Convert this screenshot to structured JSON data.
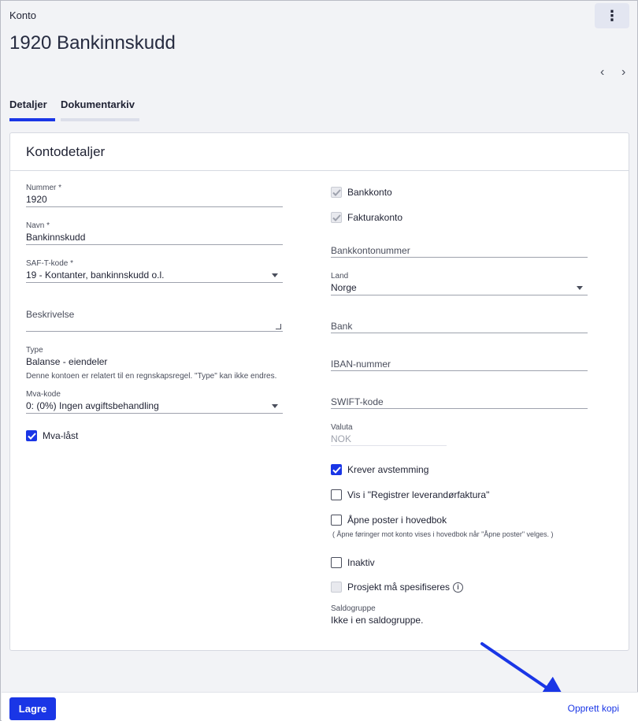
{
  "header": {
    "eyebrow": "Konto",
    "title": "1920 Bankinnskudd",
    "menu_icon": "⋮",
    "prev_icon": "‹",
    "next_icon": "›"
  },
  "tabs": [
    {
      "label": "Detaljer",
      "active": true
    },
    {
      "label": "Dokumentarkiv",
      "active": false
    }
  ],
  "card": {
    "title": "Kontodetaljer",
    "left": {
      "nummer": {
        "label": "Nummer *",
        "value": "1920"
      },
      "navn": {
        "label": "Navn *",
        "value": "Bankinnskudd"
      },
      "saft": {
        "label": "SAF-T-kode *",
        "value": "19 - Kontanter, bankinnskudd o.l."
      },
      "beskrivelse": {
        "placeholder": "Beskrivelse"
      },
      "type": {
        "label": "Type",
        "value": "Balanse - eiendeler",
        "hint": "Denne kontoen er relatert til en regnskapsregel. \"Type\" kan ikke endres."
      },
      "mva": {
        "label": "Mva-kode",
        "value": "0: (0%) Ingen avgiftsbehandling"
      },
      "mva_laast": {
        "label": "Mva-låst",
        "checked": true
      }
    },
    "right": {
      "bankkonto": {
        "label": "Bankkonto",
        "checked": true,
        "disabled": true
      },
      "fakturakonto": {
        "label": "Fakturakonto",
        "checked": true,
        "disabled": true
      },
      "bankkontonummer": {
        "placeholder": "Bankkontonummer"
      },
      "land": {
        "label": "Land",
        "value": "Norge"
      },
      "bank": {
        "placeholder": "Bank"
      },
      "iban": {
        "placeholder": "IBAN-nummer"
      },
      "swift": {
        "placeholder": "SWIFT-kode"
      },
      "valuta": {
        "label": "Valuta",
        "value": "NOK"
      },
      "krever_avstemming": {
        "label": "Krever avstemming",
        "checked": true
      },
      "vis_registrer": {
        "label": "Vis i \"Registrer leverandørfaktura\"",
        "checked": false
      },
      "aapne_poster": {
        "label": "Åpne poster i hovedbok",
        "checked": false,
        "hint": "( Åpne føringer mot konto vises i hovedbok når \"Åpne poster\" velges. )"
      },
      "inaktiv": {
        "label": "Inaktiv",
        "checked": false
      },
      "prosjekt": {
        "label": "Prosjekt må spesifiseres",
        "checked": false,
        "disabled": true
      },
      "saldogruppe": {
        "label": "Saldogruppe",
        "value": "Ikke i en saldogruppe."
      }
    }
  },
  "footer": {
    "save_label": "Lagre",
    "copy_label": "Opprett kopi"
  },
  "colors": {
    "accent": "#1a36e6",
    "annotation_arrow": "#1a36e6"
  }
}
